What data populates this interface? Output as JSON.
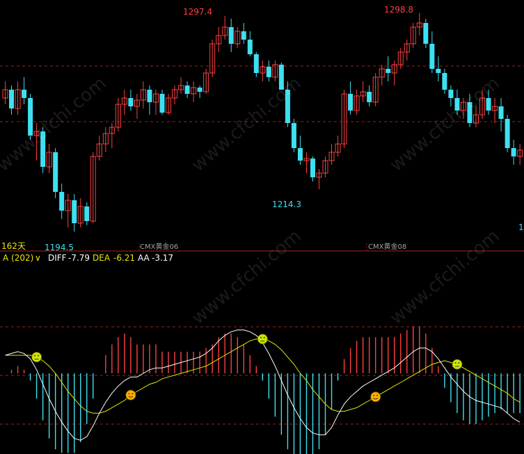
{
  "chart_data": [
    {
      "type": "candlestick",
      "period_label": "162天",
      "contract_labels": [
        "CMX黄金06",
        "CMX黄金08"
      ],
      "price_annotations": {
        "high1": "1297.4",
        "high2": "1298.8",
        "low1": "1194.5",
        "low2": "1214.3",
        "right_edge": "1"
      },
      "up_color": "#ff4040",
      "down_color": "#3de0f0",
      "candles": [
        [
          1258,
          1266,
          1255,
          1262
        ],
        [
          1262,
          1264,
          1250,
          1253
        ],
        [
          1253,
          1266,
          1250,
          1262
        ],
        [
          1262,
          1268,
          1255,
          1258
        ],
        [
          1258,
          1260,
          1238,
          1240
        ],
        [
          1240,
          1246,
          1228,
          1242
        ],
        [
          1242,
          1244,
          1222,
          1225
        ],
        [
          1225,
          1236,
          1222,
          1232
        ],
        [
          1232,
          1234,
          1210,
          1213
        ],
        [
          1213,
          1217,
          1200,
          1204
        ],
        [
          1204,
          1212,
          1196,
          1209
        ],
        [
          1209,
          1212,
          1194,
          1198
        ],
        [
          1198,
          1210,
          1196,
          1206
        ],
        [
          1206,
          1208,
          1197,
          1199
        ],
        [
          1199,
          1232,
          1198,
          1230
        ],
        [
          1230,
          1240,
          1228,
          1236
        ],
        [
          1236,
          1244,
          1232,
          1241
        ],
        [
          1241,
          1246,
          1234,
          1244
        ],
        [
          1244,
          1258,
          1242,
          1255
        ],
        [
          1255,
          1262,
          1250,
          1258
        ],
        [
          1258,
          1262,
          1252,
          1254
        ],
        [
          1254,
          1260,
          1248,
          1257
        ],
        [
          1257,
          1266,
          1253,
          1262
        ],
        [
          1262,
          1264,
          1250,
          1256
        ],
        [
          1256,
          1262,
          1250,
          1260
        ],
        [
          1260,
          1262,
          1250,
          1251
        ],
        [
          1251,
          1260,
          1250,
          1258
        ],
        [
          1258,
          1264,
          1255,
          1262
        ],
        [
          1262,
          1268,
          1260,
          1264
        ],
        [
          1264,
          1266,
          1258,
          1260
        ],
        [
          1260,
          1266,
          1256,
          1263
        ],
        [
          1263,
          1264,
          1258,
          1261
        ],
        [
          1261,
          1272,
          1260,
          1270
        ],
        [
          1270,
          1286,
          1268,
          1284
        ],
        [
          1284,
          1292,
          1280,
          1288
        ],
        [
          1288,
          1297.4,
          1286,
          1292
        ],
        [
          1292,
          1296,
          1280,
          1284
        ],
        [
          1284,
          1292,
          1282,
          1290
        ],
        [
          1290,
          1294,
          1284,
          1286
        ],
        [
          1286,
          1290,
          1278,
          1279
        ],
        [
          1279,
          1280,
          1268,
          1270
        ],
        [
          1270,
          1276,
          1266,
          1273
        ],
        [
          1273,
          1276,
          1266,
          1268
        ],
        [
          1268,
          1276,
          1266,
          1274
        ],
        [
          1274,
          1275,
          1262,
          1262
        ],
        [
          1262,
          1266,
          1244,
          1246
        ],
        [
          1246,
          1248,
          1232,
          1234
        ],
        [
          1234,
          1240,
          1226,
          1228
        ],
        [
          1228,
          1232,
          1222,
          1229
        ],
        [
          1229,
          1230,
          1218,
          1220
        ],
        [
          1220,
          1224,
          1214.3,
          1222
        ],
        [
          1222,
          1230,
          1220,
          1228
        ],
        [
          1228,
          1236,
          1226,
          1232
        ],
        [
          1232,
          1240,
          1230,
          1236
        ],
        [
          1236,
          1262,
          1234,
          1260
        ],
        [
          1260,
          1266,
          1250,
          1252
        ],
        [
          1252,
          1262,
          1250,
          1259
        ],
        [
          1259,
          1266,
          1256,
          1261
        ],
        [
          1261,
          1264,
          1254,
          1256
        ],
        [
          1256,
          1270,
          1254,
          1268
        ],
        [
          1268,
          1274,
          1264,
          1272
        ],
        [
          1272,
          1278,
          1266,
          1270
        ],
        [
          1270,
          1276,
          1264,
          1274
        ],
        [
          1274,
          1282,
          1272,
          1280
        ],
        [
          1280,
          1286,
          1276,
          1284
        ],
        [
          1284,
          1294,
          1282,
          1292
        ],
        [
          1292,
          1298.8,
          1288,
          1294
        ],
        [
          1294,
          1296,
          1282,
          1284
        ],
        [
          1284,
          1290,
          1270,
          1272
        ],
        [
          1272,
          1278,
          1266,
          1270
        ],
        [
          1270,
          1272,
          1260,
          1262
        ],
        [
          1262,
          1264,
          1254,
          1258
        ],
        [
          1258,
          1262,
          1250,
          1252
        ],
        [
          1252,
          1258,
          1248,
          1256
        ],
        [
          1256,
          1260,
          1244,
          1246
        ],
        [
          1246,
          1254,
          1244,
          1250
        ],
        [
          1250,
          1262,
          1248,
          1258
        ],
        [
          1258,
          1262,
          1250,
          1252
        ],
        [
          1252,
          1258,
          1246,
          1254
        ],
        [
          1254,
          1258,
          1242,
          1248
        ],
        [
          1248,
          1250,
          1232,
          1234
        ],
        [
          1234,
          1238,
          1226,
          1230
        ],
        [
          1230,
          1236,
          1226,
          1233
        ]
      ]
    },
    {
      "type": "macd",
      "indicator_name": "A (202)",
      "dropdown_glyph": "∨",
      "diff_label": "DIFF",
      "diff_value": "-7.79",
      "dea_label": "DEA",
      "dea_value": "-6.21",
      "aa_label": "AA",
      "aa_value": "-3.17",
      "diff_color": "#ffffff",
      "dea_color": "#e8e800",
      "diff": [
        10,
        11,
        12,
        11,
        8,
        2,
        -6,
        -14,
        -21,
        -27,
        -32,
        -36,
        -37,
        -35,
        -29,
        -22,
        -16,
        -11,
        -7,
        -4,
        -2,
        -2,
        0,
        2,
        3,
        3,
        4,
        5,
        6,
        7,
        8,
        9,
        11,
        14,
        18,
        21,
        23,
        24,
        24,
        23,
        21,
        17,
        11,
        4,
        -4,
        -12,
        -19,
        -25,
        -30,
        -33,
        -34,
        -34,
        -30,
        -23,
        -17,
        -13,
        -10,
        -7,
        -5,
        -3,
        -1,
        1,
        3,
        6,
        9,
        12,
        14,
        14,
        12,
        8,
        3,
        -2,
        -6,
        -10,
        -13,
        -15,
        -16,
        -17,
        -18,
        -19,
        -22,
        -25,
        -27
      ],
      "dea": [
        10,
        10,
        10,
        10,
        10,
        9,
        7,
        4,
        0,
        -5,
        -10,
        -14,
        -18,
        -21,
        -22,
        -22,
        -21,
        -19,
        -17,
        -15,
        -12,
        -10,
        -8,
        -6,
        -5,
        -3,
        -2,
        -1,
        0,
        1,
        2,
        3,
        4,
        6,
        8,
        10,
        12,
        14,
        16,
        18,
        19,
        19,
        18,
        16,
        13,
        9,
        5,
        0,
        -4,
        -9,
        -13,
        -17,
        -20,
        -21,
        -21,
        -20,
        -19,
        -17,
        -15,
        -13,
        -11,
        -9,
        -7,
        -5,
        -3,
        -1,
        1,
        3,
        5,
        6,
        7,
        6,
        5,
        3,
        1,
        -1,
        -3,
        -5,
        -7,
        -9,
        -11,
        -14,
        -16
      ],
      "signals": [
        {
          "i": 5,
          "mood": "neutral"
        },
        {
          "i": 20,
          "mood": "happy"
        },
        {
          "i": 41,
          "mood": "neutral"
        },
        {
          "i": 59,
          "mood": "happy"
        },
        {
          "i": 72,
          "mood": "neutral"
        }
      ],
      "hist_up_color": "#ff4040",
      "hist_down_color": "#3de0f0"
    }
  ]
}
